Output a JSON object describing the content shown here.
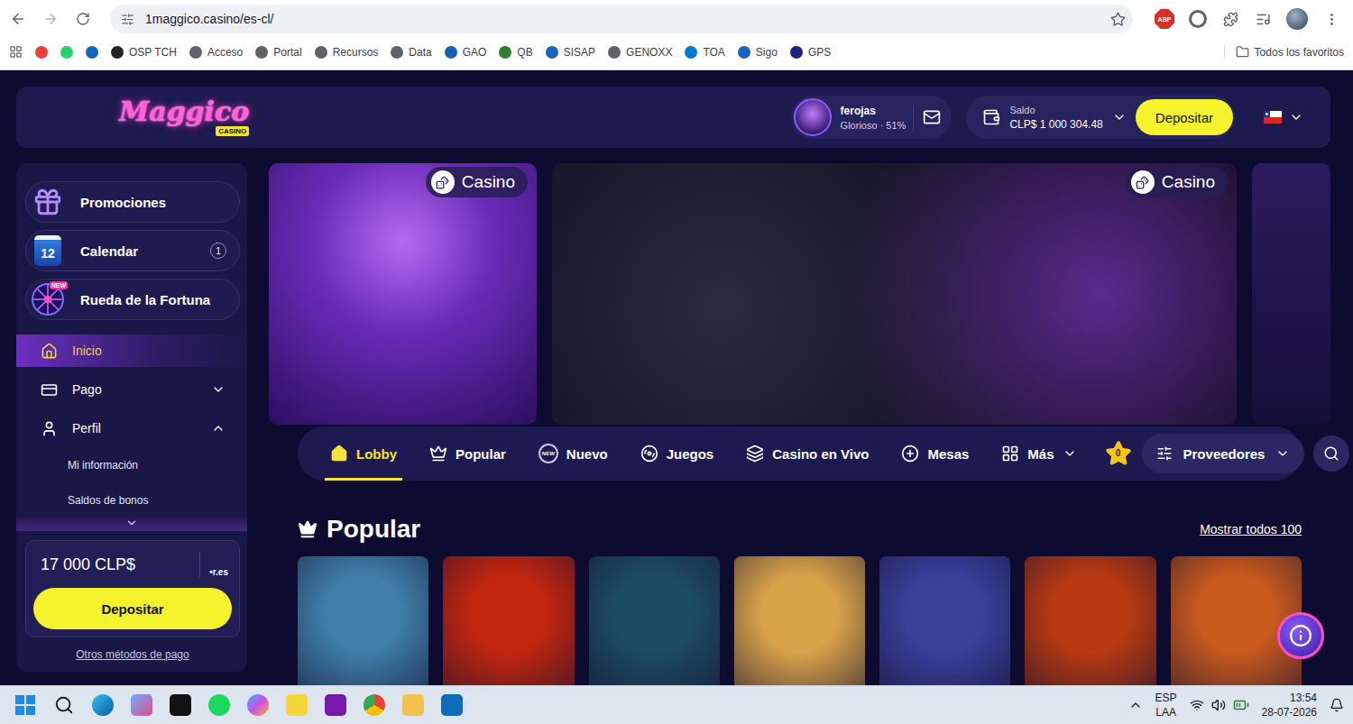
{
  "browser": {
    "url": "1maggico.casino/es-cl/",
    "bookmarked": false,
    "extension_badge": "ABP"
  },
  "bookmarks": {
    "icon_items": [
      {
        "color": "#ea4335"
      },
      {
        "color": "#25d366"
      },
      {
        "color": "#1565c0"
      }
    ],
    "items": [
      {
        "label": "OSP TCH",
        "color": "#222222"
      },
      {
        "label": "Acceso",
        "color": "#5f6368"
      },
      {
        "label": "Portal",
        "color": "#5f6368"
      },
      {
        "label": "Recursos",
        "color": "#5f6368"
      },
      {
        "label": "Data",
        "color": "#5f6368"
      },
      {
        "label": "GAO",
        "color": "#1a5fb4"
      },
      {
        "label": "QB",
        "color": "#2e7d32"
      },
      {
        "label": "SISAP",
        "color": "#1565c0"
      },
      {
        "label": "GENOXX",
        "color": "#5f6368"
      },
      {
        "label": "TOA",
        "color": "#0078d4"
      },
      {
        "label": "Sigo",
        "color": "#1565c0"
      },
      {
        "label": "GPS",
        "color": "#1a237e"
      }
    ],
    "all": "Todos los favoritos"
  },
  "header": {
    "logo": "Maggico",
    "logo_badge": "CASINO",
    "user": {
      "name": "ferojas",
      "level": "Glorioso · 51%"
    },
    "balance": {
      "label": "Saldo",
      "amount": "CLP$ 1 000 304.48"
    },
    "deposit_button": "Depositar"
  },
  "sidebar": {
    "promos": [
      {
        "label": "Promociones",
        "badge": "",
        "icon_text": "",
        "icon_badge": ""
      },
      {
        "label": "Calendar",
        "badge": "1",
        "icon_text": "12",
        "icon_badge": ""
      },
      {
        "label": "Rueda de la Fortuna",
        "badge": "",
        "icon_text": "",
        "icon_badge": "NEW"
      }
    ],
    "menu": [
      {
        "label": "Inicio",
        "kind": "link",
        "selected": true,
        "expanded": false,
        "children": []
      },
      {
        "label": "Pago",
        "kind": "group",
        "selected": false,
        "expanded": false,
        "children": []
      },
      {
        "label": "Perfil",
        "kind": "group",
        "selected": false,
        "expanded": true,
        "children": [
          "Mi información",
          "Saldos de bonos"
        ]
      }
    ],
    "deposit_card": {
      "amount": "17 000 CLP$",
      "payment_logo": "•r.es",
      "button": "Depositar",
      "link": "Otros métodos de pago"
    }
  },
  "banners": [
    {
      "tag": "Casino"
    },
    {
      "tag": "Casino"
    },
    {
      "tag": ""
    }
  ],
  "nav": {
    "tabs": [
      {
        "label": "Lobby",
        "selected": true,
        "dropdown": false,
        "icon_badge": ""
      },
      {
        "label": "Popular",
        "selected": false,
        "dropdown": false,
        "icon_badge": ""
      },
      {
        "label": "Nuevo",
        "selected": false,
        "dropdown": false,
        "icon_badge": "NEW"
      },
      {
        "label": "Juegos",
        "selected": false,
        "dropdown": false,
        "icon_badge": ""
      },
      {
        "label": "Casino en Vivo",
        "selected": false,
        "dropdown": false,
        "icon_badge": ""
      },
      {
        "label": "Mesas",
        "selected": false,
        "dropdown": false,
        "icon_badge": ""
      },
      {
        "label": "Más",
        "selected": false,
        "dropdown": true,
        "icon_badge": ""
      }
    ],
    "favorites_count": "0",
    "providers": "Proveedores"
  },
  "section": {
    "title": "Popular",
    "link": "Mostrar todos 100",
    "games": [
      {
        "color": "#3f7fa8"
      },
      {
        "color": "#c2260f"
      },
      {
        "color": "#1d4b63"
      },
      {
        "color": "#d9a34a"
      },
      {
        "color": "#3a3f9a"
      },
      {
        "color": "#b83a12"
      },
      {
        "color": "#c95a1e"
      }
    ]
  },
  "taskbar": {
    "language": "ESP",
    "layout": "LAA",
    "time": "13:54",
    "date": "28-07-2026"
  }
}
